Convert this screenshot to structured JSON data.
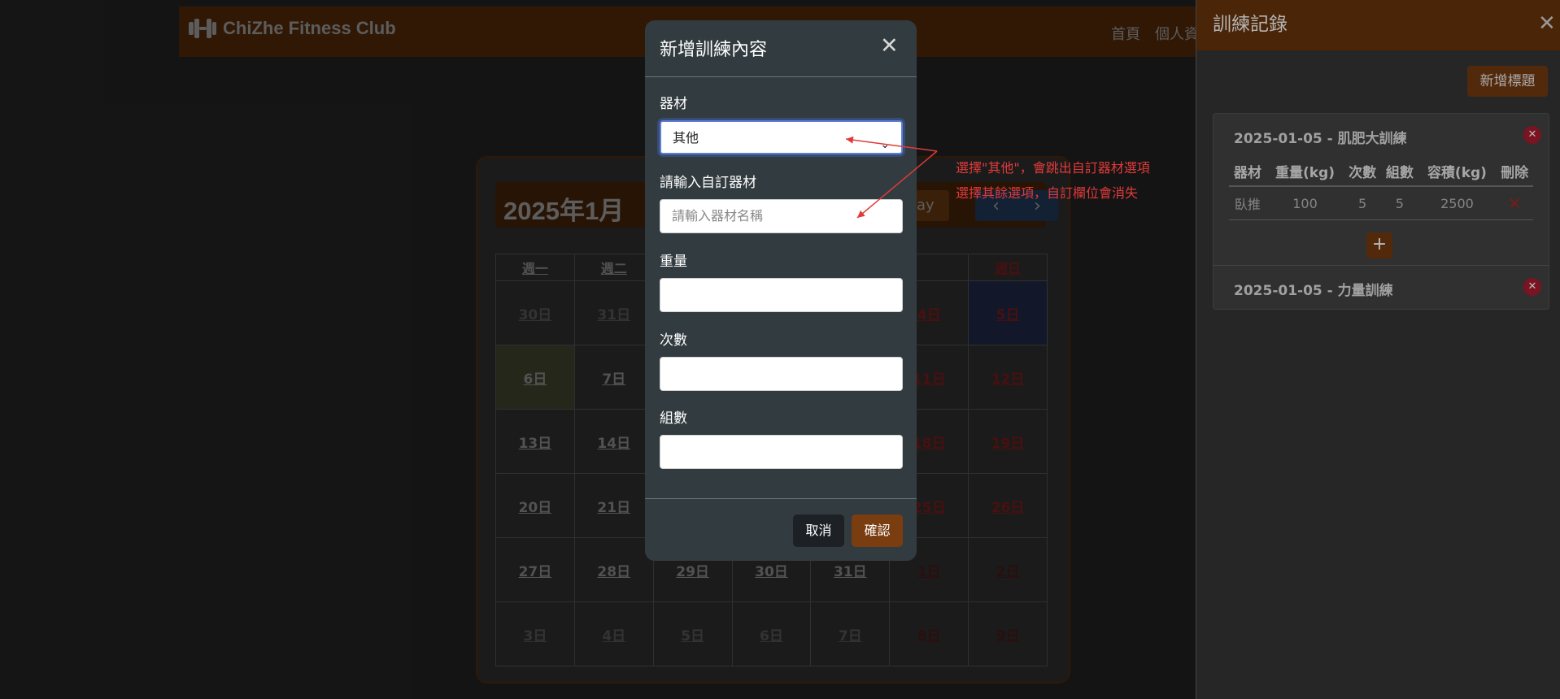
{
  "navbar": {
    "brand": "ChiZhe Fitness Club",
    "links": [
      "首頁",
      "個人資"
    ]
  },
  "calendar": {
    "title": "2025年1月",
    "today_label": "ay",
    "prev_icon": "chevron-left-icon",
    "next_icon": "chevron-right-icon",
    "weekdays": [
      "週一",
      "週二",
      "",
      "",
      "",
      "",
      "週日"
    ],
    "weeks": [
      [
        "30日",
        "31日",
        "",
        "",
        "",
        "4日",
        "5日"
      ],
      [
        "6日",
        "7日",
        "",
        "",
        "",
        "11日",
        "12日"
      ],
      [
        "13日",
        "14日",
        "",
        "",
        "",
        "18日",
        "19日"
      ],
      [
        "20日",
        "21日",
        "",
        "",
        "",
        "25日",
        "26日"
      ],
      [
        "27日",
        "28日",
        "29日",
        "30日",
        "31日",
        "1日",
        "2日"
      ],
      [
        "3日",
        "4日",
        "5日",
        "6日",
        "7日",
        "8日",
        "9日"
      ]
    ]
  },
  "sidebar": {
    "title": "訓練記錄",
    "add_title_button": "新增標題",
    "records": [
      {
        "title": "2025-01-05 - 肌肥大訓練",
        "columns": [
          "器材",
          "重量(kg)",
          "次數",
          "組數",
          "容積(kg)",
          "刪除"
        ],
        "rows": [
          [
            "臥推",
            "100",
            "5",
            "5",
            "2500"
          ]
        ],
        "add_button": "+"
      },
      {
        "title": "2025-01-05 - 力量訓練"
      }
    ]
  },
  "modal": {
    "title": "新增訓練內容",
    "equipment_label": "器材",
    "equipment_value": "其他",
    "custom_label": "請輸入自訂器材",
    "custom_placeholder": "請輸入器材名稱",
    "weight_label": "重量",
    "reps_label": "次數",
    "sets_label": "組數",
    "cancel": "取消",
    "confirm": "確認"
  },
  "annotation": {
    "line1": "選擇\"其他\"，會跳出自訂器材選項",
    "line2": "選擇其餘選項，自訂欄位會消失",
    "color": "#e23a3a"
  },
  "colors": {
    "brand_dark": "#4a2508",
    "confirm": "#7a3d10",
    "modal_bg": "#323b3f"
  }
}
